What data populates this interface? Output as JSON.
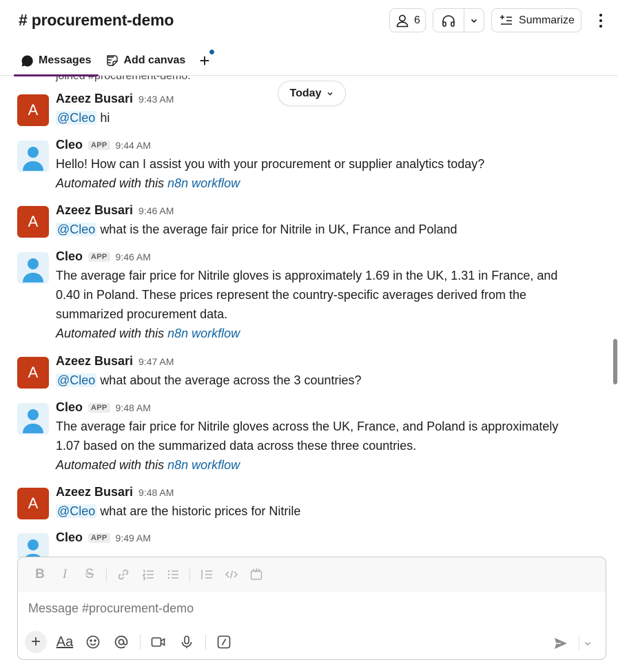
{
  "header": {
    "channel_title": "# procurement-demo",
    "member_count": "6",
    "summarize_label": "Summarize"
  },
  "tabs": {
    "messages": "Messages",
    "add_canvas": "Add canvas"
  },
  "timeline": {
    "joined_text": "joined #procurement-demo.",
    "date_divider": "Today"
  },
  "messages": [
    {
      "author": "Azeez Busari",
      "avatar_letter": "A",
      "time": "9:43 AM",
      "mention": "@Cleo",
      "text": "hi"
    },
    {
      "author": "Cleo",
      "badge": "APP",
      "time": "9:44 AM",
      "text": "Hello! How can I assist you with your procurement or supplier analytics today?",
      "automated_prefix": "Automated with this ",
      "automated_link": "n8n workflow"
    },
    {
      "author": "Azeez Busari",
      "avatar_letter": "A",
      "time": "9:46 AM",
      "mention": "@Cleo",
      "text": "what is the average fair price for Nitrile in UK, France and Poland"
    },
    {
      "author": "Cleo",
      "badge": "APP",
      "time": "9:46 AM",
      "text_lines": [
        "The average fair price for Nitrile gloves is approximately 1.69 in the UK, 1.31 in France, and",
        "0.40 in Poland. These prices represent the country-specific averages derived from the",
        "summarized procurement data."
      ],
      "automated_prefix": "Automated with this ",
      "automated_link": "n8n workflow"
    },
    {
      "author": "Azeez Busari",
      "avatar_letter": "A",
      "time": "9:47 AM",
      "mention": "@Cleo",
      "text": "what about the average across the 3 countries?"
    },
    {
      "author": "Cleo",
      "badge": "APP",
      "time": "9:48 AM",
      "text_lines": [
        "The average fair price for Nitrile gloves across the UK, France, and Poland is approximately",
        "1.07 based on the summarized data across these three countries."
      ],
      "automated_prefix": "Automated with this ",
      "automated_link": "n8n workflow"
    },
    {
      "author": "Azeez Busari",
      "avatar_letter": "A",
      "time": "9:48 AM",
      "mention": "@Cleo",
      "text": "what are the historic prices for Nitrile"
    },
    {
      "author": "Cleo",
      "badge": "APP",
      "time": "9:49 AM"
    }
  ],
  "composer": {
    "placeholder": "Message #procurement-demo",
    "format_label": "Aa"
  },
  "colors": {
    "user_avatar": "#c43b16",
    "bot_avatar_bg": "#e6f2fa",
    "link": "#1264a3",
    "tab_underline": "#611f69"
  }
}
